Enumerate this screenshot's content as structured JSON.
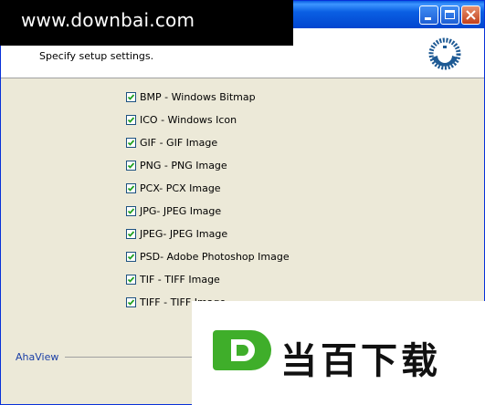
{
  "watermark_top": "www.downbai.com",
  "watermark_bottom": "当百下载",
  "header": {
    "subtitle": "Specify setup settings."
  },
  "formats": [
    {
      "label": "BMP - Windows Bitmap",
      "checked": true
    },
    {
      "label": "ICO - Windows Icon",
      "checked": true
    },
    {
      "label": "GIF - GIF Image",
      "checked": true
    },
    {
      "label": "PNG - PNG Image",
      "checked": true
    },
    {
      "label": "PCX- PCX Image",
      "checked": true
    },
    {
      "label": "JPG- JPEG Image",
      "checked": true
    },
    {
      "label": "JPEG- JPEG Image",
      "checked": true
    },
    {
      "label": "PSD- Adobe Photoshop Image",
      "checked": true
    },
    {
      "label": "TIF - TIFF Image",
      "checked": true
    },
    {
      "label": "TIFF - TIFF Image",
      "checked": true
    }
  ],
  "footer": {
    "brand": "AhaView"
  },
  "colors": {
    "titlebar": "#0a5fe3",
    "checkmark": "#21a121",
    "footer_brand": "#1b3fa6",
    "watermark_green": "#3fae2a"
  },
  "icons": {
    "window_controls": [
      "minimize-icon",
      "maximize-icon",
      "close-icon"
    ],
    "header_logo": "setup-logo-icon"
  }
}
